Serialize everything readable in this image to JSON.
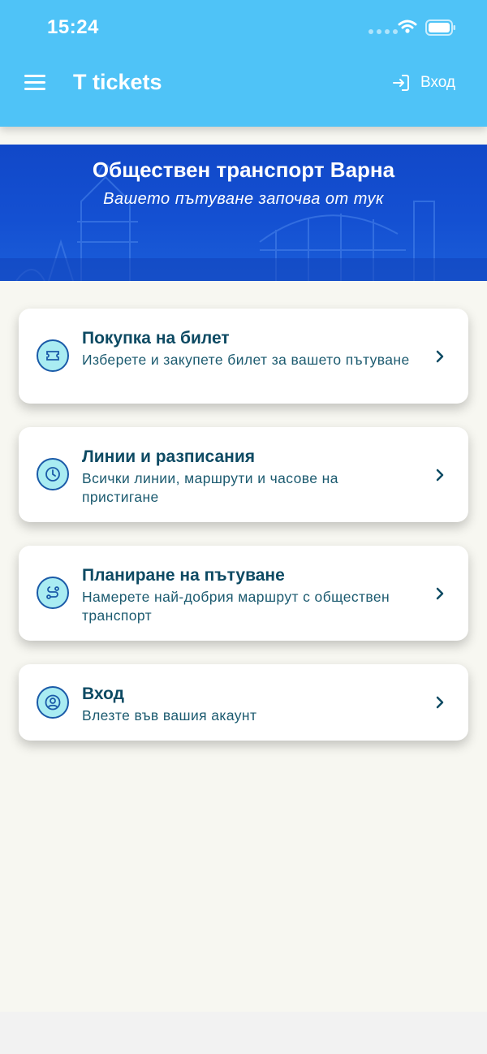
{
  "status_bar": {
    "time": "15:24"
  },
  "header": {
    "title": "T tickets",
    "login_label": "Вход"
  },
  "banner": {
    "title": "Обществен транспорт Варна",
    "subtitle": "Вашето пътуване започва от тук"
  },
  "cards": [
    {
      "title": "Покупка на билет",
      "description": "Изберете и закупете билет за вашето пътуване",
      "icon": "ticket-icon"
    },
    {
      "title": "Линии и разписания",
      "description": "Всички линии, маршрути и часове на пристигане",
      "icon": "clock-icon"
    },
    {
      "title": "Планиране на пътуване",
      "description": "Намерете най-добрия маршрут с обществен транспорт",
      "icon": "route-icon"
    },
    {
      "title": "Вход",
      "description": "Влезте във вашия акаунт",
      "icon": "user-icon"
    }
  ],
  "colors": {
    "header": "#4fc3f7",
    "banner": "#1450d2",
    "background": "#f7f7f1",
    "card_title": "#0d4a63",
    "icon_fill": "#a9ecf2"
  }
}
